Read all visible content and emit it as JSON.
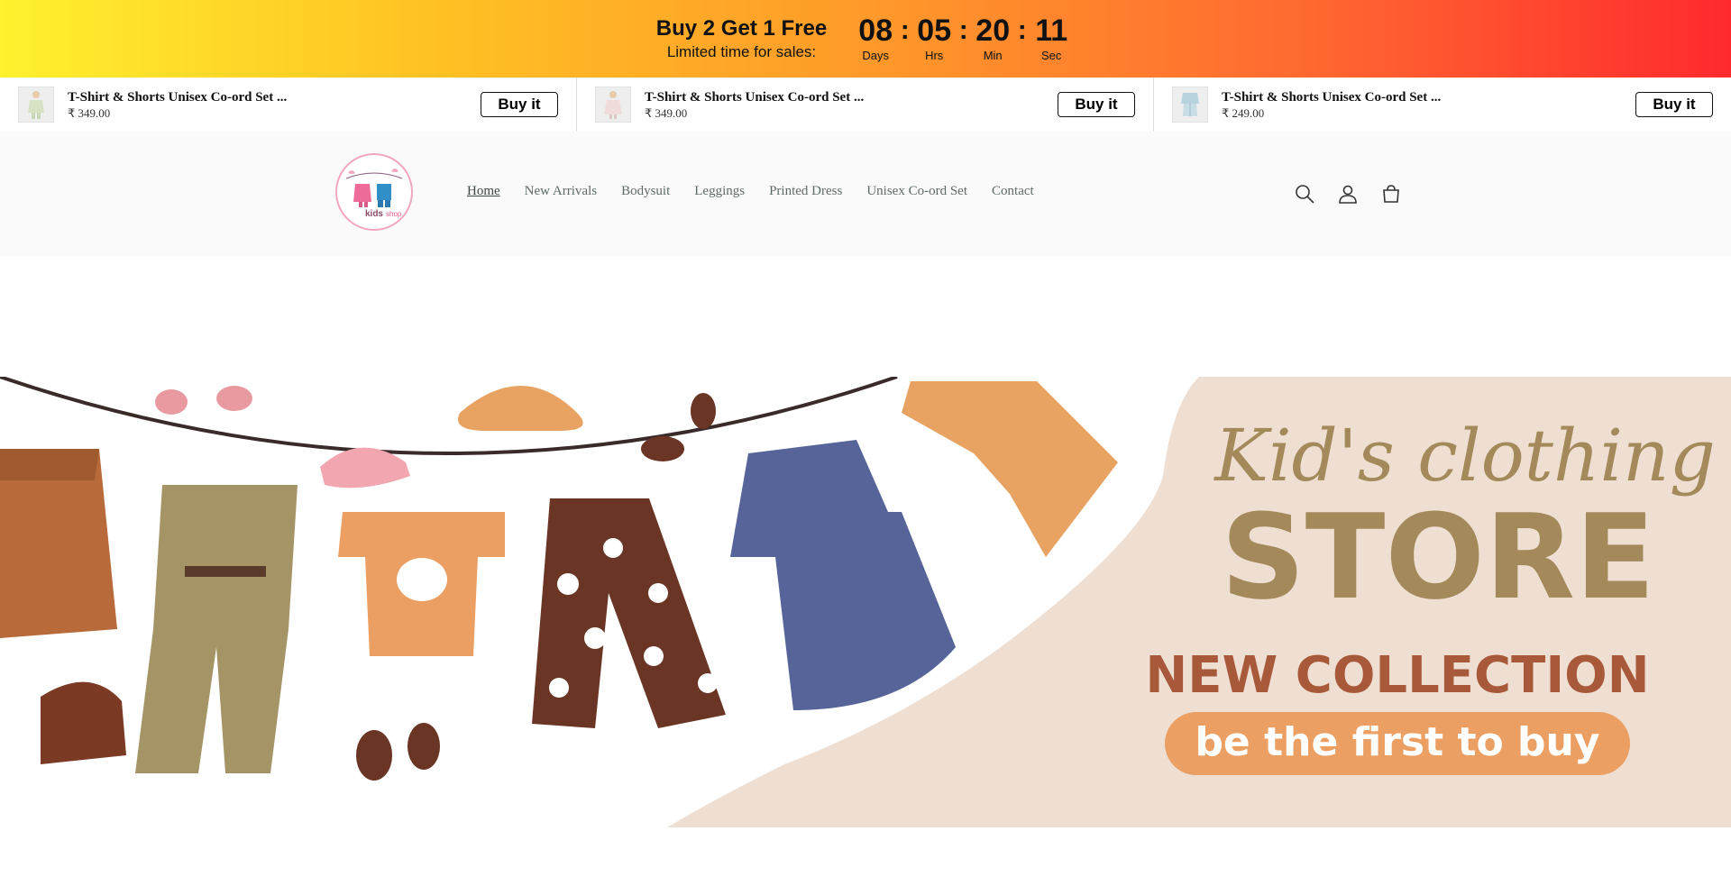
{
  "promo": {
    "title": "Buy 2 Get 1 Free",
    "subtitle": "Limited time for sales:",
    "countdown": [
      {
        "value": "08",
        "label": "Days"
      },
      {
        "value": "05",
        "label": "Hrs"
      },
      {
        "value": "20",
        "label": "Min"
      },
      {
        "value": "11",
        "label": "Sec"
      }
    ],
    "separator": ":"
  },
  "strip": [
    {
      "name": "T-Shirt & Shorts Unisex Co-ord Set ...",
      "price": "₹ 349.00",
      "button": "Buy it"
    },
    {
      "name": "T-Shirt & Shorts Unisex Co-ord Set ...",
      "price": "₹ 349.00",
      "button": "Buy it"
    },
    {
      "name": "T-Shirt & Shorts Unisex Co-ord Set ...",
      "price": "₹ 249.00",
      "button": "Buy it"
    }
  ],
  "header": {
    "logo_text": "kids shop",
    "nav": [
      "Home",
      "New Arrivals",
      "Bodysuit",
      "Leggings",
      "Printed Dress",
      "Unisex Co-ord Set",
      "Contact"
    ],
    "icons": [
      "search-icon",
      "account-icon",
      "cart-icon"
    ]
  },
  "hero": {
    "headline_script": "Kid's clothing",
    "headline_main": "STORE",
    "collection": "NEW COLLECTION",
    "cta": "be the first to buy"
  },
  "colors": {
    "banner_bg": "#efdfd3",
    "title_brown": "#a48a5a",
    "collection_brown": "#a8593a",
    "cta_orange": "#ec9f62"
  }
}
